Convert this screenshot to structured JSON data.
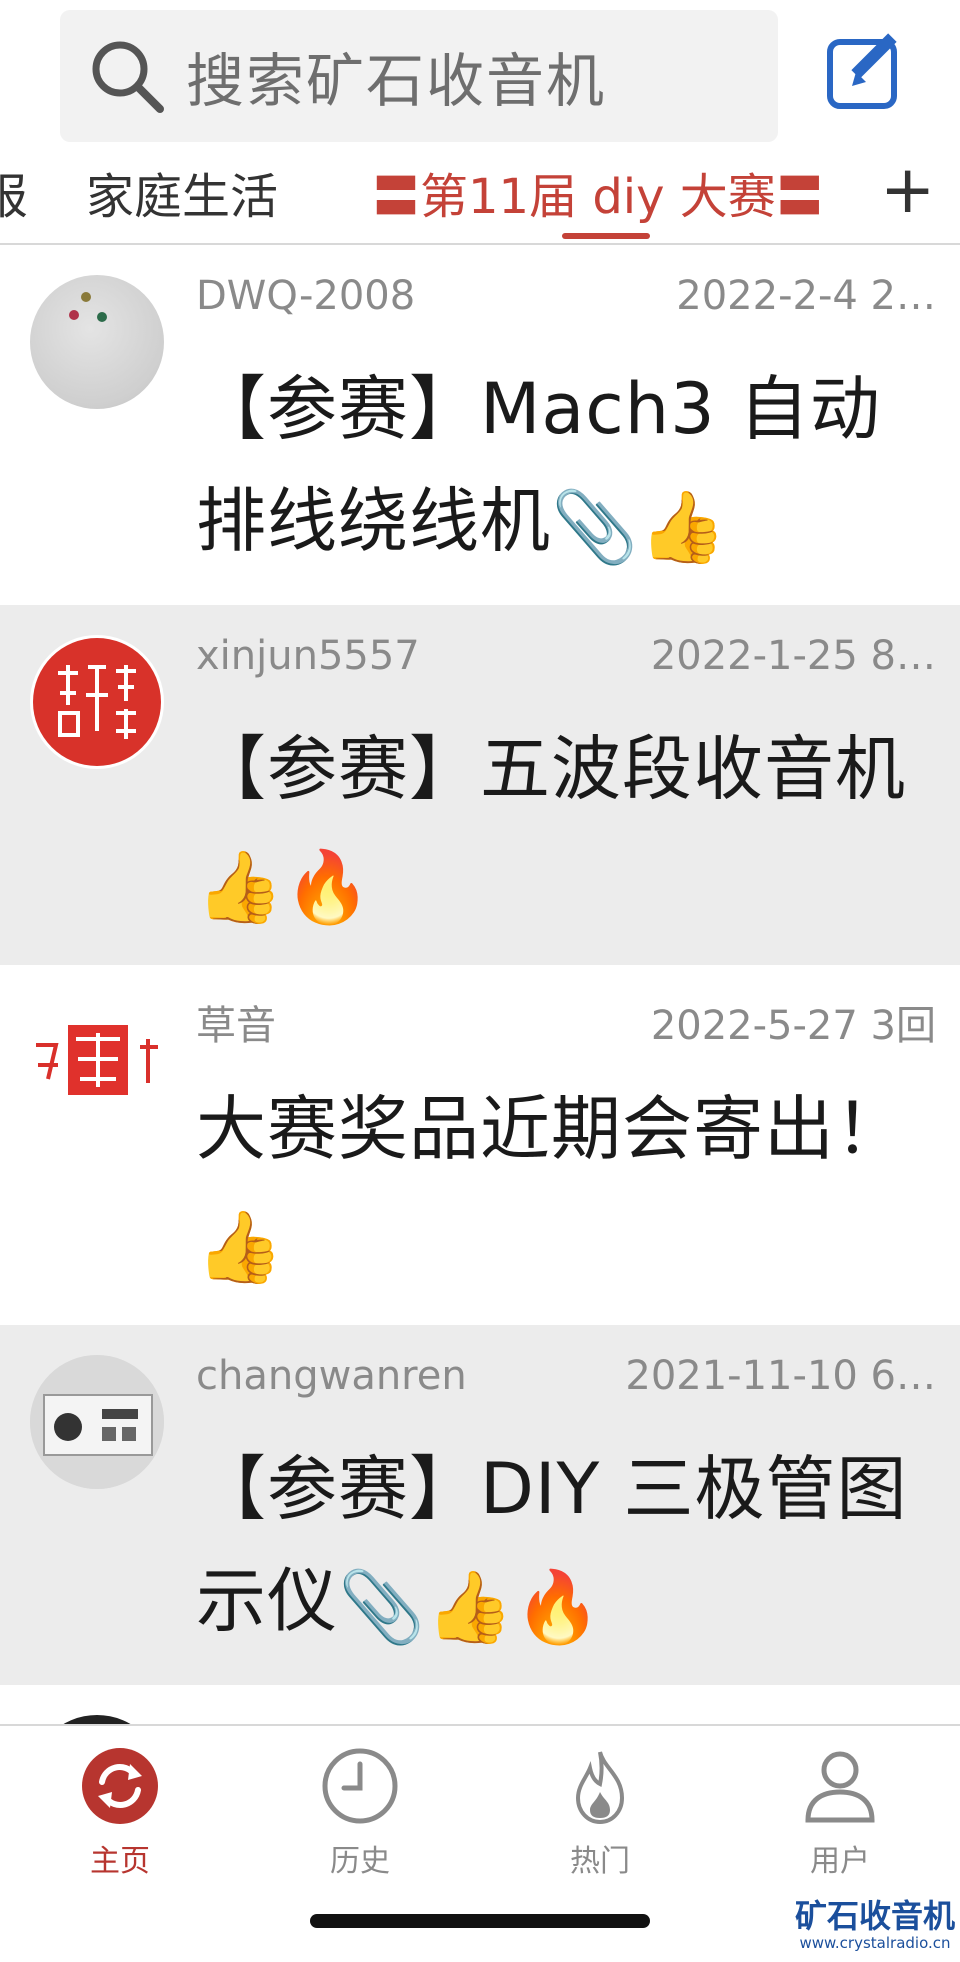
{
  "search": {
    "placeholder": "搜索矿石收音机",
    "icon": "search-icon"
  },
  "header": {
    "compose_icon": "compose-icon"
  },
  "tabs": {
    "items": [
      {
        "label": "报"
      },
      {
        "label": "家庭生活"
      },
      {
        "label": "〓第11届 diy 大赛〓",
        "active": true
      }
    ],
    "add_label": "+"
  },
  "posts": [
    {
      "author": "DWQ-2008",
      "date": "2022-2-4 2…",
      "title": "【参赛】Mach3 自动排线绕线机",
      "emoji": [
        "paperclip",
        "thumbs-up"
      ],
      "highlighted": false
    },
    {
      "author": "xinjun5557",
      "date": "2022-1-25 8…",
      "title": "【参赛】五波段收音机",
      "emoji": [
        "thumbs-up",
        "fire"
      ],
      "highlighted": true
    },
    {
      "author": "草音",
      "date": "2022-5-27 3回",
      "title": "大赛奖品近期会寄出！",
      "emoji": [
        "thumbs-up"
      ],
      "highlighted": false
    },
    {
      "author": "changwanren",
      "date": "2021-11-10 6…",
      "title": "【参赛】DIY 三极管图示仪",
      "emoji": [
        "paperclip",
        "thumbs-up",
        "fire"
      ],
      "highlighted": true
    }
  ],
  "bottom_nav": [
    {
      "label": "主页",
      "icon": "refresh-icon",
      "active": true
    },
    {
      "label": "历史",
      "icon": "clock-icon",
      "active": false
    },
    {
      "label": "热门",
      "icon": "flame-icon",
      "active": false
    },
    {
      "label": "用户",
      "icon": "user-icon",
      "active": false
    }
  ],
  "watermark": {
    "main": "矿石收音机",
    "url": "www.crystalradio.cn"
  },
  "colors": {
    "accent": "#c44238",
    "brand": "#1b4f9c",
    "alt_row": "#ececec"
  }
}
